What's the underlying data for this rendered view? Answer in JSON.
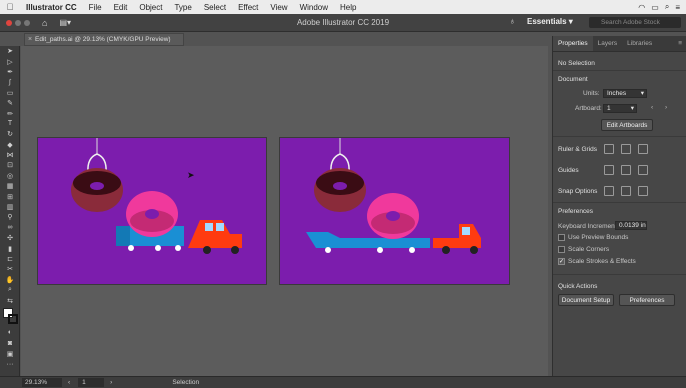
{
  "menubar": {
    "app": "Illustrator CC",
    "items": [
      "File",
      "Edit",
      "Object",
      "Type",
      "Select",
      "Effect",
      "View",
      "Window",
      "Help"
    ]
  },
  "appbar": {
    "title": "Adobe Illustrator CC 2019",
    "workspace": "Essentials",
    "search_placeholder": "Search Adobe Stock"
  },
  "document": {
    "tab": "Edit_paths.ai @ 29.13% (CMYK/GPU Preview)"
  },
  "status": {
    "zoom": "29.13%",
    "page": "1",
    "tool": "Selection"
  },
  "panel": {
    "tabs": [
      "Properties",
      "Layers",
      "Libraries"
    ],
    "no_selection": "No Selection",
    "document_heading": "Document",
    "units_label": "Units:",
    "units_value": "Inches",
    "artboard_label": "Artboard:",
    "artboard_value": "1",
    "edit_artboards": "Edit Artboards",
    "ruler_grids": "Ruler & Grids",
    "guides": "Guides",
    "snap_options": "Snap Options",
    "preferences_heading": "Preferences",
    "keyboard_increment_label": "Keyboard Increment:",
    "keyboard_increment_value": "0.0139 in",
    "use_preview_bounds": "Use Preview Bounds",
    "scale_corners": "Scale Corners",
    "scale_strokes": "Scale Strokes & Effects",
    "quick_actions": "Quick Actions",
    "document_setup": "Document Setup",
    "preferences_button": "Preferences"
  },
  "colors": {
    "artboard": "#7c1dad",
    "donut_dough": "#8a2b3a",
    "pink_donut": "#f0399c",
    "car": "#ff3b10",
    "truck": "#1a8fd4"
  }
}
